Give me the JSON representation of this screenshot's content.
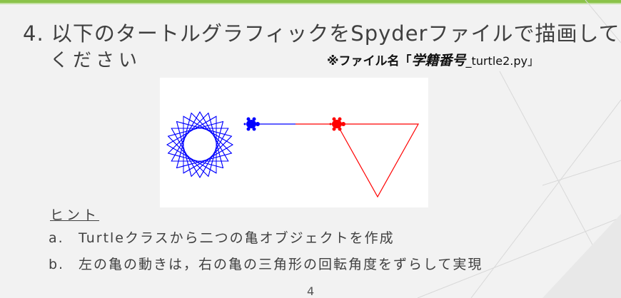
{
  "slide": {
    "title": "4. 以下のタートルグラフィックをSpyderファイルで描画して",
    "title_cont": "ください",
    "file_note": {
      "prefix": "※ファイル名「",
      "name": "学籍番号",
      "suffix": "_turtle2.py」"
    },
    "figure": {
      "left_turtle_color": "#0000ff",
      "right_turtle_color": "#ff0000"
    },
    "hint": {
      "title": "ヒント",
      "items": [
        {
          "marker": "a.",
          "text": "Turtleクラスから二つの亀オブジェクトを作成"
        },
        {
          "marker": "b.",
          "text": "左の亀の動きは，右の亀の三角形の回転角度をずらして実現"
        }
      ]
    },
    "page_number": "4",
    "accent_color": "#8bc34a"
  }
}
